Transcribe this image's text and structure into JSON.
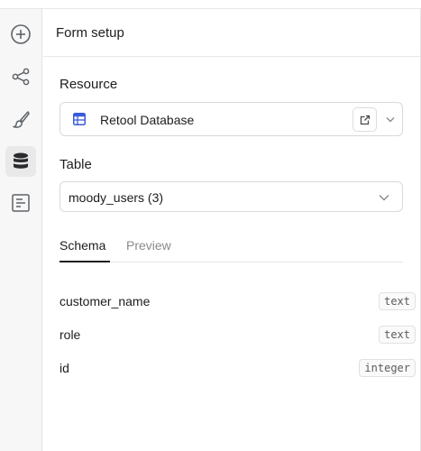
{
  "panel": {
    "title": "Form setup"
  },
  "sidebar": {
    "items": [
      {
        "name": "add-icon",
        "active": false
      },
      {
        "name": "share-nodes-icon",
        "active": false
      },
      {
        "name": "paintbrush-icon",
        "active": false
      },
      {
        "name": "database-icon",
        "active": true
      },
      {
        "name": "form-icon",
        "active": false
      }
    ]
  },
  "resource": {
    "label": "Resource",
    "value": "Retool Database",
    "icon": "table-grid-icon",
    "accent_color": "#3b5bdb"
  },
  "table": {
    "label": "Table",
    "value": "moody_users (3)"
  },
  "tabs": [
    {
      "label": "Schema",
      "active": true
    },
    {
      "label": "Preview",
      "active": false
    }
  ],
  "schema": [
    {
      "name": "customer_name",
      "type": "text"
    },
    {
      "name": "role",
      "type": "text"
    },
    {
      "name": "id",
      "type": "integer"
    }
  ]
}
